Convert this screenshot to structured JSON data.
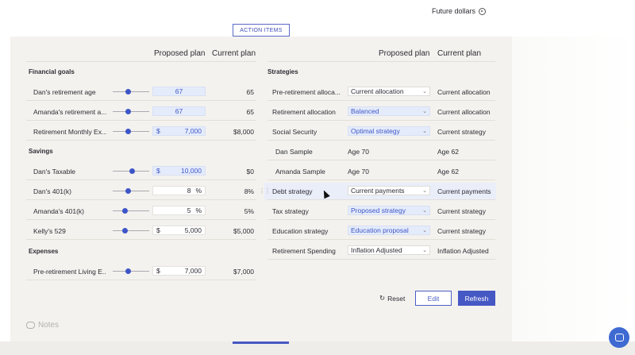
{
  "top": {
    "future_label": "Future dollars",
    "action_tab": "ACTION ITEMS"
  },
  "left": {
    "proposed_header": "Proposed plan",
    "current_header": "Current plan",
    "financial_goals": {
      "title": "Financial goals",
      "rows": [
        {
          "label": "Dan's retirement age",
          "slider_level": 0.4,
          "currency": "",
          "value": "67",
          "percent": "",
          "current": "65",
          "highlight": true
        },
        {
          "label": "Amanda's retirement a...",
          "slider_level": 0.4,
          "currency": "",
          "value": "67",
          "percent": "",
          "current": "65",
          "highlight": true
        },
        {
          "label": "Retirement Monthly Ex...",
          "slider_level": 0.4,
          "currency": "$",
          "value": "7,000",
          "percent": "",
          "current": "$8,000",
          "highlight": true
        }
      ]
    },
    "savings": {
      "title": "Savings",
      "rows": [
        {
          "label": "Dan's Taxable",
          "slider_level": 0.55,
          "currency": "$",
          "value": "10,000",
          "percent": "",
          "current": "$0",
          "highlight": true
        },
        {
          "label": "Dan's 401(k)",
          "slider_level": 0.4,
          "currency": "",
          "value": "8",
          "percent": "%",
          "current": "8%",
          "highlight": false
        },
        {
          "label": "Amanda's 401(k)",
          "slider_level": 0.3,
          "currency": "",
          "value": "5",
          "percent": "%",
          "current": "5%",
          "highlight": false
        },
        {
          "label": "Kelly's 529",
          "slider_level": 0.3,
          "currency": "$",
          "value": "5,000",
          "percent": "",
          "current": "$5,000",
          "highlight": false
        }
      ]
    },
    "expenses": {
      "title": "Expenses",
      "rows": [
        {
          "label": "Pre-retirement Living E...",
          "slider_level": 0.4,
          "currency": "$",
          "value": "7,000",
          "percent": "",
          "current": "$7,000",
          "highlight": false
        }
      ]
    }
  },
  "right": {
    "title": "Strategies",
    "proposed_header": "Proposed plan",
    "current_header": "Current plan",
    "rows": [
      {
        "label": "Pre-retirement alloca...",
        "proposed": "Current allocation",
        "type": "select",
        "highlight": false,
        "current": "Current allocation"
      },
      {
        "label": "Retirement allocation",
        "proposed": "Balanced",
        "type": "select",
        "highlight": true,
        "current": "Current allocation"
      },
      {
        "label": "Social Security",
        "proposed": "Optimal strategy",
        "type": "select",
        "highlight": true,
        "current": "Current strategy"
      },
      {
        "label": "Dan Sample",
        "proposed": "Age 70",
        "type": "text",
        "highlight": false,
        "current": "Age 62"
      },
      {
        "label": "Amanda Sample",
        "proposed": "Age 70",
        "type": "text",
        "highlight": false,
        "current": "Age 62"
      },
      {
        "label": "Debt strategy",
        "proposed": "Current payments",
        "type": "select",
        "highlight": false,
        "current": "Current payments"
      },
      {
        "label": "Tax strategy",
        "proposed": "Proposed strategy",
        "type": "select",
        "highlight": true,
        "current": "Current strategy"
      },
      {
        "label": "Education strategy",
        "proposed": "Education proposal",
        "type": "select",
        "highlight": true,
        "current": "Current strategy"
      },
      {
        "label": "Retirement Spending",
        "proposed": "Inflation Adjusted",
        "type": "select",
        "highlight": false,
        "current": "Inflation Adjusted"
      }
    ]
  },
  "actions": {
    "reset": "Reset",
    "edit": "Edit",
    "refresh": "Refresh"
  },
  "notes": {
    "label": "Notes"
  },
  "colors": {
    "accent": "#4658c4",
    "highlight_bg": "#e4ebfa",
    "panel_bg": "#f4f2ee"
  }
}
